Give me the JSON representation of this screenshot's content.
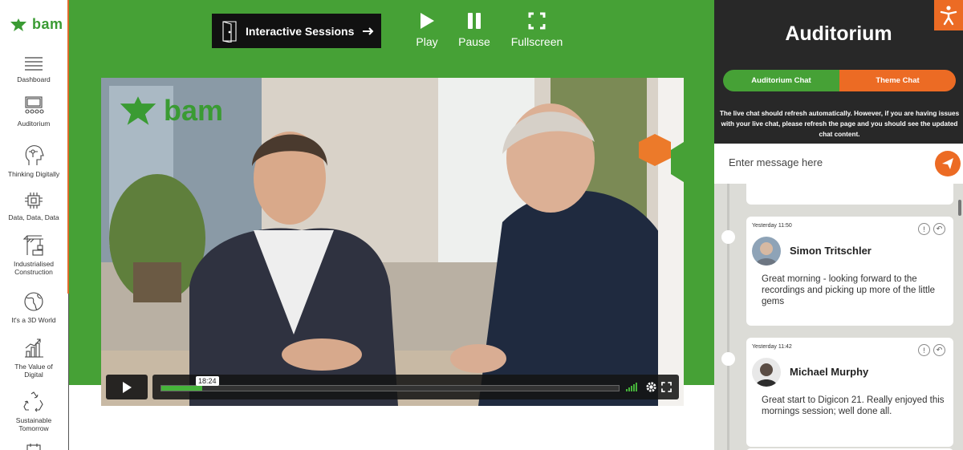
{
  "sidebar": {
    "logo": "bam",
    "items": [
      {
        "label": "Dashboard",
        "icon": "menu-lines-icon"
      },
      {
        "label": "Auditorium",
        "icon": "auditorium-icon"
      },
      {
        "label": "Thinking Digitally",
        "icon": "head-circuit-icon"
      },
      {
        "label": "Data, Data, Data",
        "icon": "data-chip-icon"
      },
      {
        "label": "Industrialised Construction",
        "icon": "crane-icon"
      },
      {
        "label": "It's a 3D World",
        "icon": "globe-icon"
      },
      {
        "label": "The Value of Digital",
        "icon": "growth-chart-icon"
      },
      {
        "label": "Sustainable Tomorrow",
        "icon": "recycle-icon"
      }
    ]
  },
  "main": {
    "interactive_label": "Interactive Sessions",
    "controls": {
      "play": "Play",
      "pause": "Pause",
      "fullscreen": "Fullscreen"
    },
    "video": {
      "watermark": "bam",
      "time": "18:24",
      "progress": 0.09
    }
  },
  "panel": {
    "title": "Auditorium",
    "tabs": {
      "auditorium": "Auditorium Chat",
      "theme": "Theme Chat"
    },
    "notice": "The live chat should refresh automatically. However, if you are having issues with your live chat, please refresh the page and you should see the updated chat content.",
    "message_placeholder": "Enter message here",
    "messages": [
      {
        "time": "Yesterday 11:50",
        "name": "Simon Tritschler",
        "text": "Great morning - looking forward to the recordings and picking up more of the little gems"
      },
      {
        "time": "Yesterday 11:42",
        "name": "Michael Murphy",
        "text": "Great start to Digicon 21. Really enjoyed this mornings session; well done all."
      }
    ]
  },
  "colors": {
    "green": "#46a136",
    "orange": "#ec6b24",
    "dark": "#282828"
  }
}
